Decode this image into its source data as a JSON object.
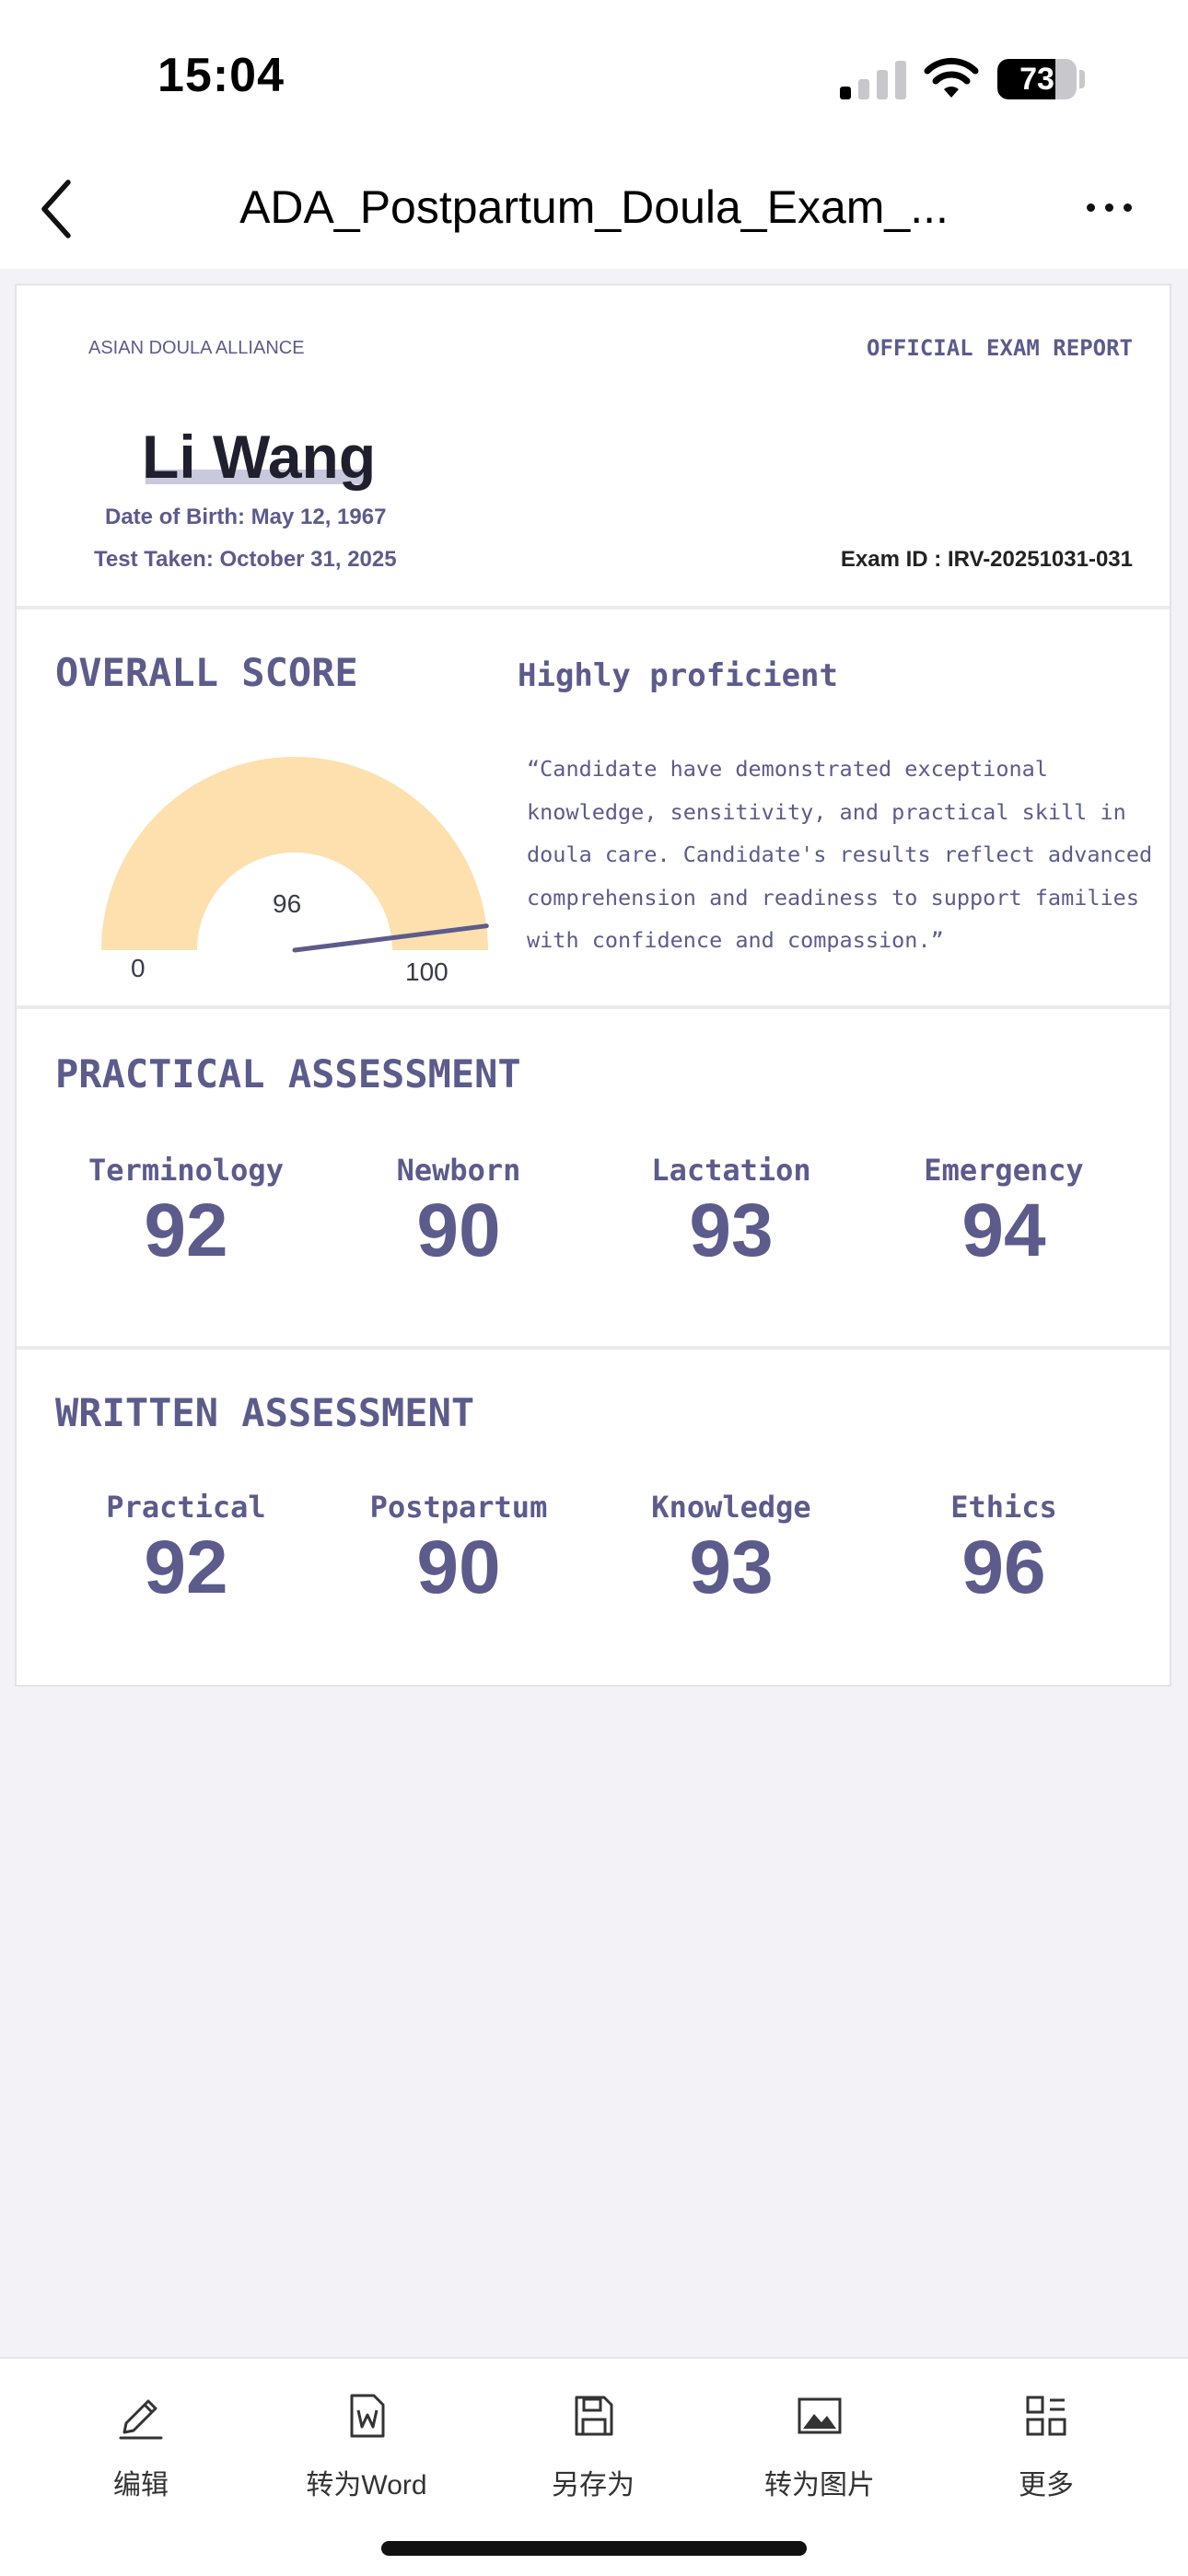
{
  "status_bar": {
    "time": "15:04",
    "battery": "73",
    "battery_level": 0.73
  },
  "nav": {
    "title": "ADA_Postpartum_Doula_Exam_..."
  },
  "report": {
    "organization": "ASIAN DOULA ALLIANCE",
    "report_type": "OFFICIAL EXAM REPORT",
    "candidate_name": "Li Wang",
    "dob_label": "Date of Birth:",
    "dob": "May 12, 1967",
    "test_label": "Test Taken:",
    "test_date": "October 31, 2025",
    "exam_id_label": "Exam ID :",
    "exam_id": "IRV-20251031-031",
    "overall": {
      "heading": "OVERALL SCORE",
      "level": "Highly proficient",
      "score": "96",
      "score_value": 96,
      "min": "0",
      "max": "100",
      "quote": "“Candidate have demonstrated exceptional knowledge, sensitivity, and practical skill in doula care. Candidate's results reflect advanced comprehension and readiness to support families with confidence and compassion.”"
    },
    "practical": {
      "heading": "PRACTICAL ASSESSMENT",
      "items": [
        {
          "label": "Terminology",
          "score": "92"
        },
        {
          "label": "Newborn",
          "score": "90"
        },
        {
          "label": "Lactation",
          "score": "93"
        },
        {
          "label": "Emergency",
          "score": "94"
        }
      ]
    },
    "written": {
      "heading": "WRITTEN ASSESSMENT",
      "items": [
        {
          "label": "Practical",
          "score": "92"
        },
        {
          "label": "Postpartum",
          "score": "90"
        },
        {
          "label": "Knowledge",
          "score": "93"
        },
        {
          "label": "Ethics",
          "score": "96"
        }
      ]
    }
  },
  "toolbar": {
    "items": [
      {
        "label": "编辑",
        "icon": "pencil-icon"
      },
      {
        "label": "转为Word",
        "icon": "word-document-icon"
      },
      {
        "label": "另存为",
        "icon": "save-icon"
      },
      {
        "label": "转为图片",
        "icon": "image-icon"
      },
      {
        "label": "更多",
        "icon": "grid-icon"
      }
    ]
  },
  "colors": {
    "accent": "#5c5b8c",
    "gauge_fill": "#fde0ae",
    "background": "#f2f2f7"
  }
}
